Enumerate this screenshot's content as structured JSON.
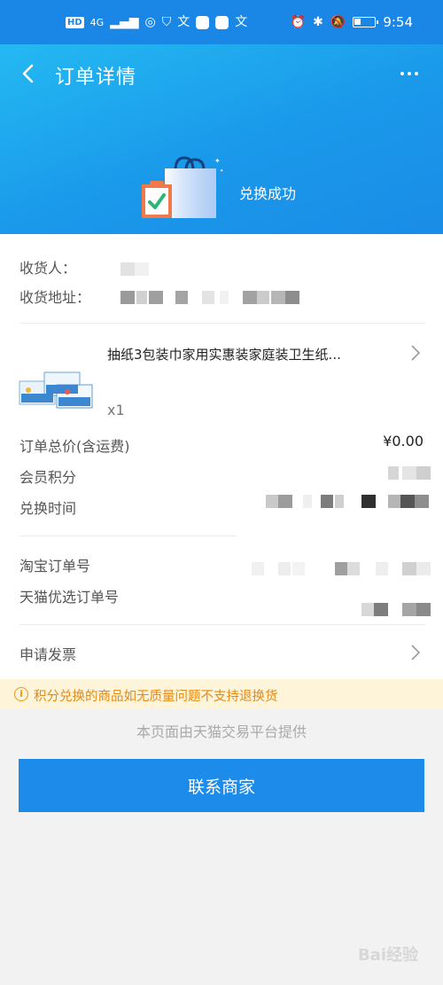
{
  "statusbar": {
    "hd": "HD",
    "network": "4G",
    "time": "9:54"
  },
  "header": {
    "title": "订单详情",
    "status": "兑换成功"
  },
  "receiver": {
    "name_label": "收货人：",
    "address_label": "收货地址："
  },
  "product": {
    "title": "抽纸3包装巾家用实惠装家庭装卫生纸...",
    "quantity": "x1"
  },
  "order": {
    "total_label": "订单总价(含运费)",
    "total_value": "¥0.00",
    "points_label": "会员积分",
    "exchange_time_label": "兑换时间",
    "taobao_order_label": "淘宝订单号",
    "tmall_order_label": "天猫优选订单号",
    "invoice_label": "申请发票"
  },
  "notice": {
    "text": "积分兑换的商品如无质量问题不支持退换货"
  },
  "footer_note": "本页面由天猫交易平台提供",
  "contact_button": "联系商家",
  "watermark": "Bai经验",
  "colors": {
    "accent": "#1c8bea",
    "notice_bg": "#fdf4d9",
    "notice_text": "#e58a16"
  }
}
